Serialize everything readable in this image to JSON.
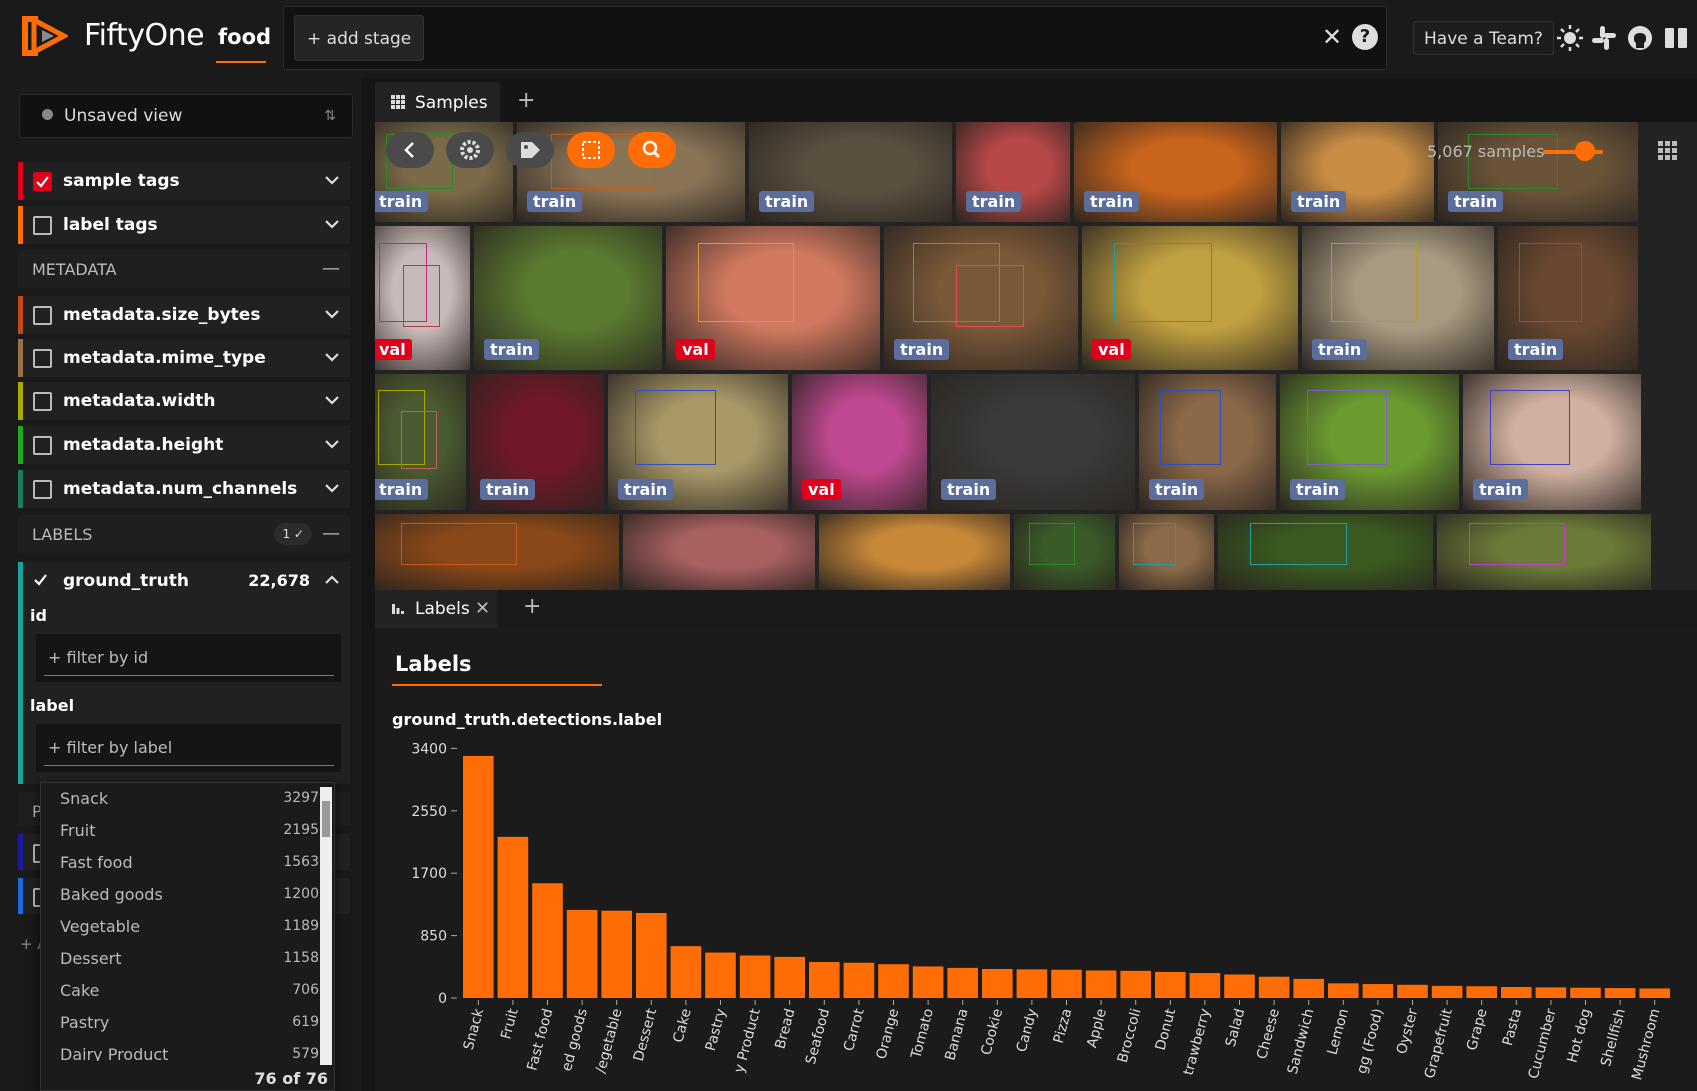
{
  "header": {
    "brand": "FiftyOne",
    "dataset": "food",
    "add_stage": "+ add stage",
    "help": "?",
    "clear": "✕",
    "team_button": "Have a Team?"
  },
  "sidebar": {
    "view": "Unsaved view",
    "rows_top": [
      {
        "label": "sample tags",
        "checked": true,
        "color": "#e0001b"
      },
      {
        "label": "label tags",
        "checked": false,
        "color": "#ff6d04"
      }
    ],
    "metadata_header": "METADATA",
    "metadata_rows": [
      {
        "label": "metadata.size_bytes",
        "color": "#c24818"
      },
      {
        "label": "metadata.mime_type",
        "color": "#9a7048"
      },
      {
        "label": "metadata.width",
        "color": "#a8a800"
      },
      {
        "label": "metadata.height",
        "color": "#22a822"
      },
      {
        "label": "metadata.num_channels",
        "color": "#1a7c5a"
      }
    ],
    "labels_header": "LABELS",
    "labels_badge": "1 ✓",
    "ground_truth": {
      "label": "ground_truth",
      "count": "22,678",
      "id_label": "id",
      "id_placeholder": "+ filter by id",
      "label_label": "label",
      "label_placeholder": "+ filter by label"
    },
    "hidden_header_letter": "P",
    "add_letter": "+ A"
  },
  "dropdown": {
    "items": [
      {
        "name": "Snack",
        "count": "3297"
      },
      {
        "name": "Fruit",
        "count": "2195"
      },
      {
        "name": "Fast food",
        "count": "1563"
      },
      {
        "name": "Baked goods",
        "count": "1200"
      },
      {
        "name": "Vegetable",
        "count": "1189"
      },
      {
        "name": "Dessert",
        "count": "1158"
      },
      {
        "name": "Cake",
        "count": "706"
      },
      {
        "name": "Pastry",
        "count": "619"
      },
      {
        "name": "Dairy Product",
        "count": "579"
      }
    ],
    "footer": "76 of 76"
  },
  "samples": {
    "tab_label": "Samples",
    "count": "5,067 samples",
    "tiles": [
      {
        "tag": "train",
        "color": "#7a6a48"
      },
      {
        "tag": "train",
        "color": "#8a7456"
      },
      {
        "tag": "train",
        "color": "#5a5040"
      },
      {
        "tag": "train",
        "color": "#b84848"
      },
      {
        "tag": "train",
        "color": "#c8641c"
      },
      {
        "tag": "train",
        "color": "#c88c44"
      },
      {
        "tag": "train",
        "color": "#6a5438"
      },
      {
        "tag": "val",
        "color": "#c8bab8"
      },
      {
        "tag": "train",
        "color": "#5a7a30"
      },
      {
        "tag": "val",
        "color": "#d07860"
      },
      {
        "tag": "train",
        "color": "#7a5838"
      },
      {
        "tag": "val",
        "color": "#c0a040"
      },
      {
        "tag": "train",
        "color": "#a89a80"
      },
      {
        "tag": "train",
        "color": "#6a4830"
      },
      {
        "tag": "train",
        "color": "#4a5a30"
      },
      {
        "tag": "train",
        "color": "#701828"
      },
      {
        "tag": "train",
        "color": "#a89868"
      },
      {
        "tag": "val",
        "color": "#c04890"
      },
      {
        "tag": "train",
        "color": "#3a3a38"
      },
      {
        "tag": "train",
        "color": "#8a6848"
      },
      {
        "tag": "train",
        "color": "#6a9a30"
      },
      {
        "tag": "train",
        "color": "#d0b0a0"
      },
      {
        "tag": "",
        "color": "#8a4818"
      },
      {
        "tag": "",
        "color": "#a86060"
      },
      {
        "tag": "",
        "color": "#c88838"
      },
      {
        "tag": "",
        "color": "#3a5a28"
      },
      {
        "tag": "",
        "color": "#8a6a48"
      },
      {
        "tag": "",
        "color": "#3a5a20"
      },
      {
        "tag": "",
        "color": "#6a7a38"
      }
    ]
  },
  "labels_panel": {
    "tab_label": "Labels",
    "close": "✕",
    "title": "Labels",
    "chart_title": "ground_truth.detections.label"
  },
  "chart_data": {
    "type": "bar",
    "title": "ground_truth.detections.label",
    "color": "#ff6d04",
    "ylim": [
      0,
      3400
    ],
    "yticks": [
      0,
      850,
      1700,
      2550,
      3400
    ],
    "tick_labels": [
      "Snack",
      "Fruit",
      "Fast food",
      "ed goods",
      "/egetable",
      "Dessert",
      "Cake",
      "Pastry",
      "y Product",
      "Bread",
      "Seafood",
      "Carrot",
      "Orange",
      "Tomato",
      "Banana",
      "Cookie",
      "Candy",
      "Pizza",
      "Apple",
      "Broccoli",
      "Donut",
      "trawberry",
      "Salad",
      "Cheese",
      "Sandwich",
      "Lemon",
      "gg (Food)",
      "Oyster",
      "Grapefruit",
      "Grape",
      "Pasta",
      "Cucumber",
      "Hot dog",
      "Shellfish",
      "Mushroom"
    ],
    "values": [
      3297,
      2195,
      1563,
      1200,
      1189,
      1158,
      706,
      619,
      579,
      560,
      490,
      480,
      460,
      430,
      410,
      395,
      390,
      385,
      375,
      370,
      355,
      340,
      320,
      290,
      260,
      200,
      190,
      180,
      165,
      160,
      150,
      145,
      140,
      135,
      130
    ]
  }
}
